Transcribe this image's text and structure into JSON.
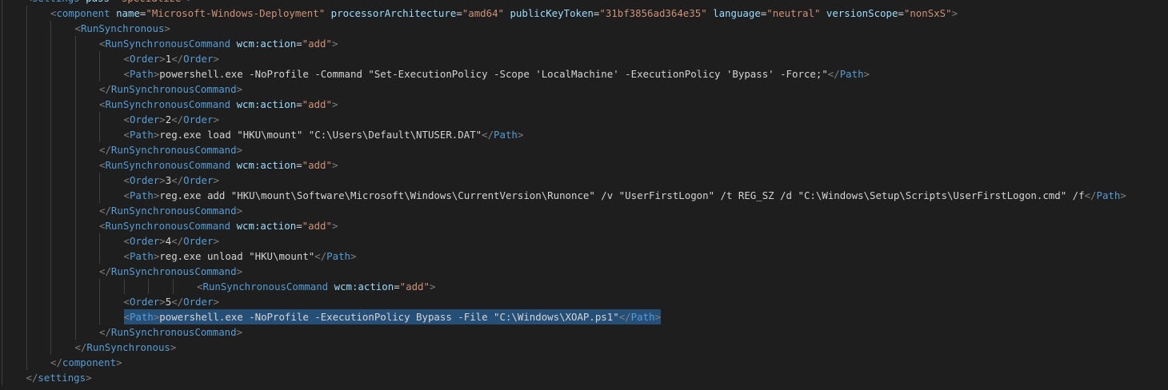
{
  "editor": {
    "language": "xml",
    "colors": {
      "background": "#1e1e1e",
      "tag": "#569cd6",
      "attribute": "#9cdcfe",
      "string": "#ce9178",
      "text": "#d4d4d4",
      "punctuation": "#808080",
      "selection": "#264f78",
      "indent_guide": "#404040"
    },
    "lines": [
      {
        "indent": 1,
        "tokens": [
          [
            "pun",
            "<"
          ],
          [
            "tag",
            "settings"
          ],
          [
            "txt",
            " "
          ],
          [
            "attr",
            "pass"
          ],
          [
            "txt",
            "="
          ],
          [
            "str",
            "\"specialize\""
          ],
          [
            "pun",
            ">"
          ]
        ]
      },
      {
        "indent": 2,
        "tokens": [
          [
            "pun",
            "<"
          ],
          [
            "tag",
            "component"
          ],
          [
            "txt",
            " "
          ],
          [
            "attr",
            "name"
          ],
          [
            "txt",
            "="
          ],
          [
            "str",
            "\"Microsoft-Windows-Deployment\""
          ],
          [
            "txt",
            " "
          ],
          [
            "attr",
            "processorArchitecture"
          ],
          [
            "txt",
            "="
          ],
          [
            "str",
            "\"amd64\""
          ],
          [
            "txt",
            " "
          ],
          [
            "attr",
            "publicKeyToken"
          ],
          [
            "txt",
            "="
          ],
          [
            "str",
            "\"31bf3856ad364e35\""
          ],
          [
            "txt",
            " "
          ],
          [
            "attr",
            "language"
          ],
          [
            "txt",
            "="
          ],
          [
            "str",
            "\"neutral\""
          ],
          [
            "txt",
            " "
          ],
          [
            "attr",
            "versionScope"
          ],
          [
            "txt",
            "="
          ],
          [
            "str",
            "\"nonSxS\""
          ],
          [
            "pun",
            ">"
          ]
        ]
      },
      {
        "indent": 3,
        "tokens": [
          [
            "pun",
            "<"
          ],
          [
            "tag",
            "RunSynchronous"
          ],
          [
            "pun",
            ">"
          ]
        ]
      },
      {
        "indent": 4,
        "tokens": [
          [
            "pun",
            "<"
          ],
          [
            "tag",
            "RunSynchronousCommand"
          ],
          [
            "txt",
            " "
          ],
          [
            "attr",
            "wcm:action"
          ],
          [
            "txt",
            "="
          ],
          [
            "str",
            "\"add\""
          ],
          [
            "pun",
            ">"
          ]
        ]
      },
      {
        "indent": 5,
        "tokens": [
          [
            "pun",
            "<"
          ],
          [
            "tag",
            "Order"
          ],
          [
            "pun",
            ">"
          ],
          [
            "txt",
            "1"
          ],
          [
            "pun",
            "</"
          ],
          [
            "tag",
            "Order"
          ],
          [
            "pun",
            ">"
          ]
        ]
      },
      {
        "indent": 5,
        "tokens": [
          [
            "pun",
            "<"
          ],
          [
            "tag",
            "Path"
          ],
          [
            "pun",
            ">"
          ],
          [
            "txt",
            "powershell.exe -NoProfile -Command \"Set-ExecutionPolicy -Scope 'LocalMachine' -ExecutionPolicy 'Bypass' -Force;\""
          ],
          [
            "pun",
            "</"
          ],
          [
            "tag",
            "Path"
          ],
          [
            "pun",
            ">"
          ]
        ]
      },
      {
        "indent": 4,
        "tokens": [
          [
            "pun",
            "</"
          ],
          [
            "tag",
            "RunSynchronousCommand"
          ],
          [
            "pun",
            ">"
          ]
        ]
      },
      {
        "indent": 4,
        "tokens": [
          [
            "pun",
            "<"
          ],
          [
            "tag",
            "RunSynchronousCommand"
          ],
          [
            "txt",
            " "
          ],
          [
            "attr",
            "wcm:action"
          ],
          [
            "txt",
            "="
          ],
          [
            "str",
            "\"add\""
          ],
          [
            "pun",
            ">"
          ]
        ]
      },
      {
        "indent": 5,
        "tokens": [
          [
            "pun",
            "<"
          ],
          [
            "tag",
            "Order"
          ],
          [
            "pun",
            ">"
          ],
          [
            "txt",
            "2"
          ],
          [
            "pun",
            "</"
          ],
          [
            "tag",
            "Order"
          ],
          [
            "pun",
            ">"
          ]
        ]
      },
      {
        "indent": 5,
        "tokens": [
          [
            "pun",
            "<"
          ],
          [
            "tag",
            "Path"
          ],
          [
            "pun",
            ">"
          ],
          [
            "txt",
            "reg.exe load \"HKU\\mount\" \"C:\\Users\\Default\\NTUSER.DAT\""
          ],
          [
            "pun",
            "</"
          ],
          [
            "tag",
            "Path"
          ],
          [
            "pun",
            ">"
          ]
        ]
      },
      {
        "indent": 4,
        "tokens": [
          [
            "pun",
            "</"
          ],
          [
            "tag",
            "RunSynchronousCommand"
          ],
          [
            "pun",
            ">"
          ]
        ]
      },
      {
        "indent": 4,
        "tokens": [
          [
            "pun",
            "<"
          ],
          [
            "tag",
            "RunSynchronousCommand"
          ],
          [
            "txt",
            " "
          ],
          [
            "attr",
            "wcm:action"
          ],
          [
            "txt",
            "="
          ],
          [
            "str",
            "\"add\""
          ],
          [
            "pun",
            ">"
          ]
        ]
      },
      {
        "indent": 5,
        "tokens": [
          [
            "pun",
            "<"
          ],
          [
            "tag",
            "Order"
          ],
          [
            "pun",
            ">"
          ],
          [
            "txt",
            "3"
          ],
          [
            "pun",
            "</"
          ],
          [
            "tag",
            "Order"
          ],
          [
            "pun",
            ">"
          ]
        ]
      },
      {
        "indent": 5,
        "tokens": [
          [
            "pun",
            "<"
          ],
          [
            "tag",
            "Path"
          ],
          [
            "pun",
            ">"
          ],
          [
            "txt",
            "reg.exe add \"HKU\\mount\\Software\\Microsoft\\Windows\\CurrentVersion\\Runonce\" /v \"UserFirstLogon\" /t REG_SZ /d \"C:\\Windows\\Setup\\Scripts\\UserFirstLogon.cmd\" /f"
          ],
          [
            "pun",
            "</"
          ],
          [
            "tag",
            "Path"
          ],
          [
            "pun",
            ">"
          ]
        ]
      },
      {
        "indent": 4,
        "tokens": [
          [
            "pun",
            "</"
          ],
          [
            "tag",
            "RunSynchronousCommand"
          ],
          [
            "pun",
            ">"
          ]
        ]
      },
      {
        "indent": 4,
        "tokens": [
          [
            "pun",
            "<"
          ],
          [
            "tag",
            "RunSynchronousCommand"
          ],
          [
            "txt",
            " "
          ],
          [
            "attr",
            "wcm:action"
          ],
          [
            "txt",
            "="
          ],
          [
            "str",
            "\"add\""
          ],
          [
            "pun",
            ">"
          ]
        ]
      },
      {
        "indent": 5,
        "tokens": [
          [
            "pun",
            "<"
          ],
          [
            "tag",
            "Order"
          ],
          [
            "pun",
            ">"
          ],
          [
            "txt",
            "4"
          ],
          [
            "pun",
            "</"
          ],
          [
            "tag",
            "Order"
          ],
          [
            "pun",
            ">"
          ]
        ]
      },
      {
        "indent": 5,
        "tokens": [
          [
            "pun",
            "<"
          ],
          [
            "tag",
            "Path"
          ],
          [
            "pun",
            ">"
          ],
          [
            "txt",
            "reg.exe unload \"HKU\\mount\""
          ],
          [
            "pun",
            "</"
          ],
          [
            "tag",
            "Path"
          ],
          [
            "pun",
            ">"
          ]
        ]
      },
      {
        "indent": 4,
        "tokens": [
          [
            "pun",
            "</"
          ],
          [
            "tag",
            "RunSynchronousCommand"
          ],
          [
            "pun",
            ">"
          ]
        ]
      },
      {
        "indent": 8,
        "tokens": [
          [
            "pun",
            "<"
          ],
          [
            "tag",
            "RunSynchronousCommand"
          ],
          [
            "txt",
            " "
          ],
          [
            "attr",
            "wcm:action"
          ],
          [
            "txt",
            "="
          ],
          [
            "str",
            "\"add\""
          ],
          [
            "pun",
            ">"
          ]
        ]
      },
      {
        "indent": 5,
        "tokens": [
          [
            "pun",
            "<"
          ],
          [
            "tag",
            "Order"
          ],
          [
            "pun",
            ">"
          ],
          [
            "txt",
            "5"
          ],
          [
            "pun",
            "</"
          ],
          [
            "tag",
            "Order"
          ],
          [
            "pun",
            ">"
          ]
        ]
      },
      {
        "indent": 5,
        "selected": true,
        "tokens": [
          [
            "pun",
            "<"
          ],
          [
            "tag",
            "Path"
          ],
          [
            "pun",
            ">"
          ],
          [
            "txt",
            "powershell.exe -NoProfile -ExecutionPolicy Bypass -File \"C:\\Windows\\XOAP.ps1\""
          ],
          [
            "pun",
            "</"
          ],
          [
            "tag",
            "Path"
          ],
          [
            "pun",
            ">"
          ]
        ]
      },
      {
        "indent": 4,
        "tokens": [
          [
            "pun",
            "</"
          ],
          [
            "tag",
            "RunSynchronousCommand"
          ],
          [
            "pun",
            ">"
          ]
        ]
      },
      {
        "indent": 3,
        "tokens": [
          [
            "pun",
            "</"
          ],
          [
            "tag",
            "RunSynchronous"
          ],
          [
            "pun",
            ">"
          ]
        ]
      },
      {
        "indent": 2,
        "tokens": [
          [
            "pun",
            "</"
          ],
          [
            "tag",
            "component"
          ],
          [
            "pun",
            ">"
          ]
        ]
      },
      {
        "indent": 1,
        "tokens": [
          [
            "pun",
            "</"
          ],
          [
            "tag",
            "settings"
          ],
          [
            "pun",
            ">"
          ]
        ]
      }
    ]
  }
}
